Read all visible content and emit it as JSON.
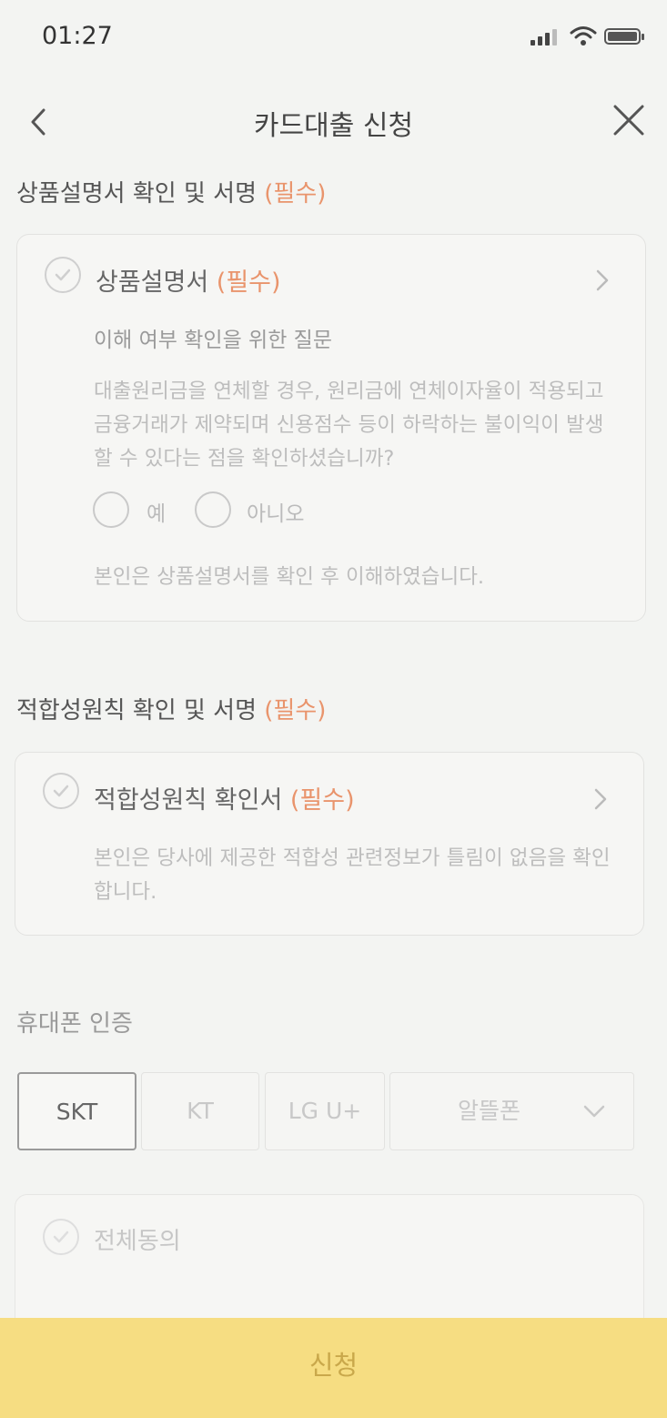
{
  "status_bar": {
    "time": "01:27"
  },
  "header": {
    "title": "카드대출 신청"
  },
  "sections": {
    "product": {
      "title": "상품설명서 확인 및 서명 ",
      "required": "(필수)",
      "card_title": "상품설명서 ",
      "card_required": "(필수)",
      "question_title": "이해 여부 확인을 위한 질문",
      "question_text": "대출원리금을 연체할 경우, 원리금에 연체이자율이 적용되고 금융거래가 제약되며 신용점수 등이 하락하는 불이익이 발생할 수 있다는 점을 확인하셨습니까?",
      "yes_label": "예",
      "no_label": "아니오",
      "confirm_text": "본인은 상품설명서를 확인 후 이해하였습니다."
    },
    "suitability": {
      "title": "적합성원칙 확인 및 서명 ",
      "required": "(필수)",
      "card_title": "적합성원칙 확인서 ",
      "card_required": "(필수)",
      "confirm_text": "본인은 당사에 제공한 적합성 관련정보가 틀림이 없음을 확인합니다."
    },
    "phone": {
      "title": "휴대폰 인증",
      "carriers": [
        "SKT",
        "KT",
        "LG U+"
      ],
      "mvno_label": "알뜰폰",
      "selected": "SKT",
      "agree_all": "전체동의"
    }
  },
  "footer": {
    "apply_label": "신청"
  },
  "colors": {
    "required": "#e9946c",
    "apply_button": "#f6dd82"
  }
}
